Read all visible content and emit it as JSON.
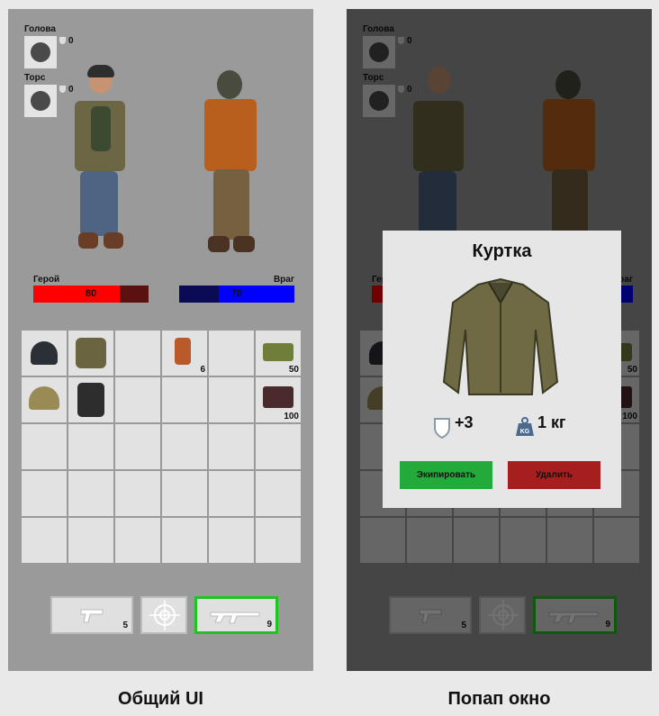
{
  "captions": {
    "left": "Общий UI",
    "right": "Попап окно"
  },
  "equipment": {
    "head": {
      "label": "Голова",
      "armor": "0",
      "icon": "helmet-icon"
    },
    "torso": {
      "label": "Торс",
      "armor": "0",
      "icon": "vest-icon"
    }
  },
  "health": {
    "hero": {
      "label": "Герой",
      "value": "80",
      "percent": 0.75,
      "color": "#ff0000",
      "bg": "#5c1111"
    },
    "enemy": {
      "label": "Враг",
      "value": "70",
      "percent": 0.66,
      "color": "#0000ff",
      "bg": "#0a0a55"
    }
  },
  "inventory": {
    "cells": [
      {
        "item": "beanie"
      },
      {
        "item": "jacket"
      },
      {
        "item": ""
      },
      {
        "item": "medkit",
        "count": "6"
      },
      {
        "item": ""
      },
      {
        "item": "ammo-box",
        "count": "50"
      },
      {
        "item": "helmet"
      },
      {
        "item": "vest"
      },
      {
        "item": ""
      },
      {
        "item": ""
      },
      {
        "item": ""
      },
      {
        "item": "ammo-pack",
        "count": "100"
      },
      {
        "item": ""
      },
      {
        "item": ""
      },
      {
        "item": ""
      },
      {
        "item": ""
      },
      {
        "item": ""
      },
      {
        "item": ""
      },
      {
        "item": ""
      },
      {
        "item": ""
      },
      {
        "item": ""
      },
      {
        "item": ""
      },
      {
        "item": ""
      },
      {
        "item": ""
      },
      {
        "item": ""
      },
      {
        "item": ""
      },
      {
        "item": ""
      },
      {
        "item": ""
      },
      {
        "item": ""
      },
      {
        "item": ""
      }
    ]
  },
  "weapons": {
    "pistol": {
      "count": "5",
      "icon": "pistol-icon"
    },
    "crosshair": {
      "icon": "crosshair-icon"
    },
    "rifle": {
      "count": "9",
      "icon": "rifle-icon",
      "active": true
    }
  },
  "popup": {
    "title": "Куртка",
    "armor": "+3",
    "weight": "1 кг",
    "weight_badge": "KG",
    "equip_label": "Экипировать",
    "delete_label": "Удалить",
    "equip_color": "#22aa3a",
    "delete_color": "#a61f1f"
  }
}
